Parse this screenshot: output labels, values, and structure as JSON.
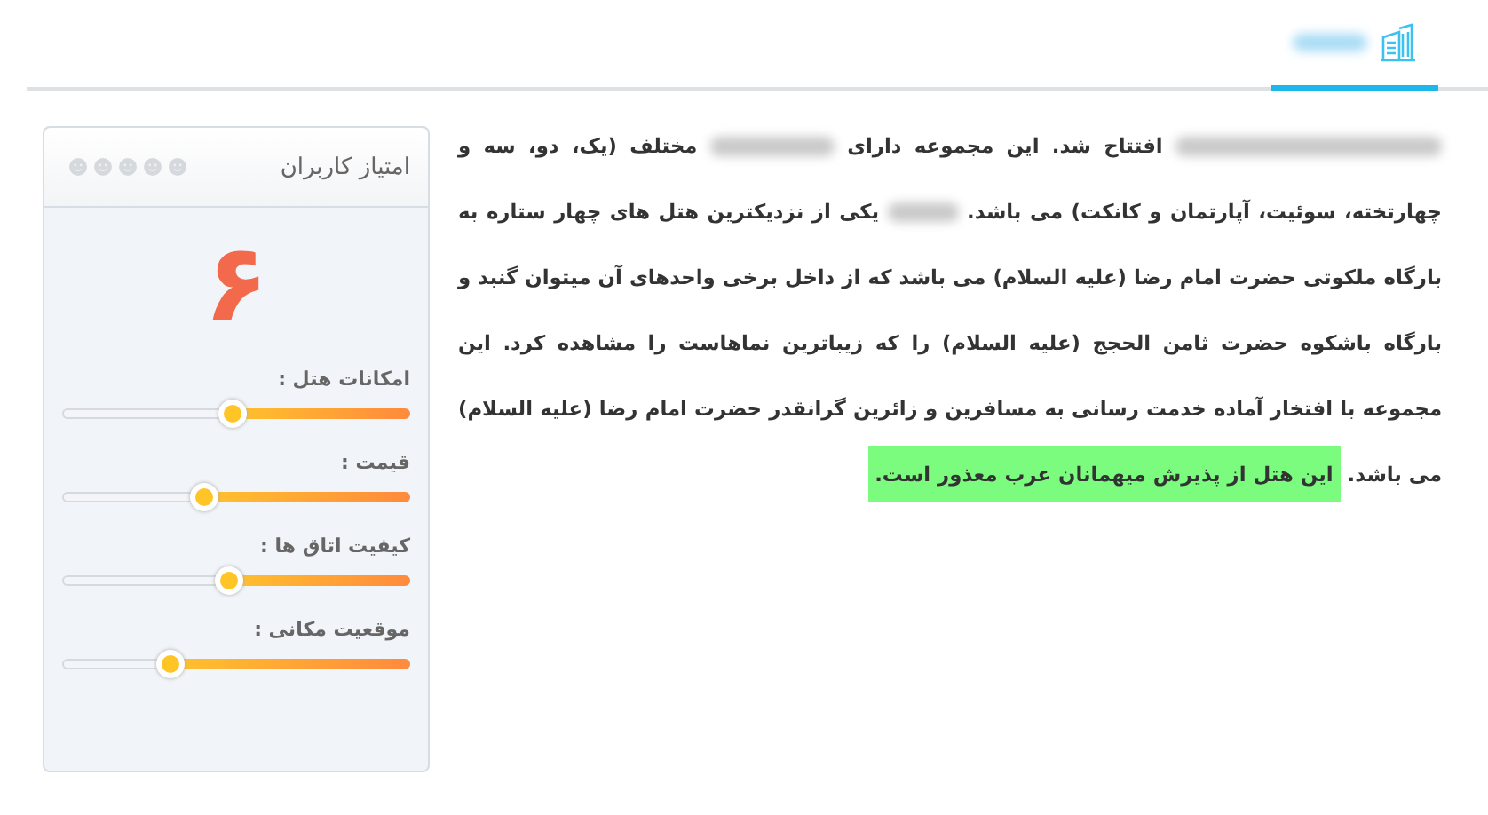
{
  "tabs": [
    {
      "selected": true
    }
  ],
  "description": {
    "segments": [
      {
        "kind": "redacted"
      },
      {
        "kind": "text",
        "text": "افتتاح شد. این مجموعه دارای"
      },
      {
        "kind": "redacted"
      },
      {
        "kind": "text",
        "text": "مختلف (یک، دو، سه و چهارتخته، سوئیت، آپارتمان و کانکت) می باشد."
      },
      {
        "kind": "redacted"
      },
      {
        "kind": "text",
        "text": "یکی از نزدیکترین هتل های چهار ستاره به بارگاه ملکوتی حضرت امام رضا (علیه السلام) می باشد که از داخل برخی واحدهای آن میتوان گنبد و بارگاه باشکوه حضرت ثامن الحجج (علیه السلام) را که زیباترین نماهاست را مشاهده کرد. این مجموعه با افتخار آماده خدمت رسانی به مسافرین و زائرین گرانقدر حضرت امام رضا (علیه السلام) می باشد."
      },
      {
        "kind": "highlight",
        "text": "این هتل از پذیرش میهمانان عرب معذور است."
      }
    ]
  },
  "rating_card": {
    "title": "امتیاز کاربران",
    "score": "۶",
    "criteria": [
      {
        "label": "امکانات هتل :",
        "level": 0.51
      },
      {
        "label": "قیمت :",
        "level": 0.59
      },
      {
        "label": "کیفیت اتاق ها :",
        "level": 0.52
      },
      {
        "label": "موقعیت مکانی :",
        "level": 0.69
      }
    ]
  }
}
